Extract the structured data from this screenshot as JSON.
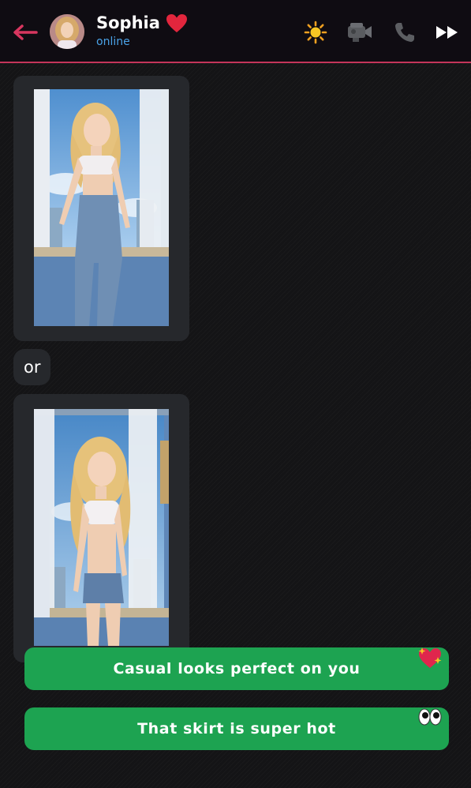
{
  "header": {
    "contact_name": "Sophia",
    "status": "online",
    "icons": {
      "back": "back-arrow-icon",
      "heart": "heart-icon",
      "sun": "sun-icon",
      "camera": "video-camera-icon",
      "phone": "phone-icon",
      "forward": "fast-forward-icon"
    }
  },
  "messages": [
    {
      "type": "image",
      "icon": "photo-image"
    },
    {
      "type": "text",
      "text": "or"
    },
    {
      "type": "image",
      "icon": "photo-image"
    }
  ],
  "replies": [
    {
      "label": "Casual looks perfect on you",
      "emoji": "sparkling-heart-icon"
    },
    {
      "label": "That skirt is super hot",
      "emoji": "eyes-icon"
    }
  ],
  "colors": {
    "accent": "#c4355a",
    "status": "#4aa3e8",
    "reply_button": "#1da351",
    "bubble": "#26282c",
    "header_bg": "#0f0c12"
  }
}
